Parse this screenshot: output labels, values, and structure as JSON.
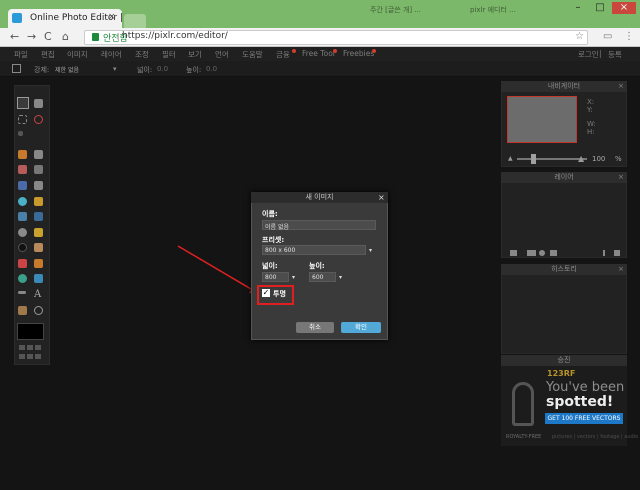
{
  "browser": {
    "tab_title": "Online Photo Editor | P",
    "tab_close": "×",
    "background_tab_text": "주간 [글쓴 개] ...",
    "background_tab_text2": "pixlr 에디터 ...",
    "window_controls": [
      "–",
      "□",
      "×"
    ],
    "nav": [
      "←",
      "→",
      "C",
      "⌂"
    ],
    "secure_label": "안전함",
    "url": "https://pixlr.com/editor/",
    "right_icons": [
      "☆",
      "▭",
      "⋮"
    ]
  },
  "menu": {
    "items": [
      "파일",
      "편집",
      "이미지",
      "레이어",
      "조정",
      "필터",
      "보기",
      "언어",
      "도움말",
      "금융",
      "Free Tool",
      "Freebies"
    ],
    "right": [
      "로그인",
      "|",
      "등록"
    ],
    "accent": "#d23c2c"
  },
  "options_bar": {
    "mode_label": "강제:",
    "mode_value": "제한 없음",
    "width_label": "넓이:",
    "width_value": "0.0",
    "height_label": "높이:",
    "height_value": "0.0"
  },
  "panels": {
    "navigator": {
      "title": "내비게이터",
      "x_label": "X:",
      "y_label": "Y:",
      "w_label": "W:",
      "h_label": "H:",
      "zoom_value": "100",
      "zoom_unit": "%"
    },
    "layers": {
      "title": "레이어"
    },
    "history": {
      "title": "히스토리"
    },
    "ad": {
      "title": "승진",
      "logo": "123RF",
      "line1": "You've been",
      "line2": "spotted!",
      "button": "GET 100 FREE VECTORS",
      "footer": "ROYALTY-FREE",
      "footer2": "pictures | vectors | footage | audio"
    }
  },
  "dialog": {
    "title": "새 이미지",
    "close": "×",
    "name_label": "이름:",
    "name_value": "이름 없음",
    "preset_label": "프리셋:",
    "preset_value": "800 x 600",
    "width_label": "넓이:",
    "width_value": "800",
    "height_label": "높이:",
    "height_value": "600",
    "transparent_label": "투명",
    "transparent_checked": true,
    "check_mark": "✓",
    "cancel_label": "취소",
    "ok_label": "확인",
    "ok_color": "#52a9d8"
  },
  "annotation": {
    "color": "#e02020"
  }
}
